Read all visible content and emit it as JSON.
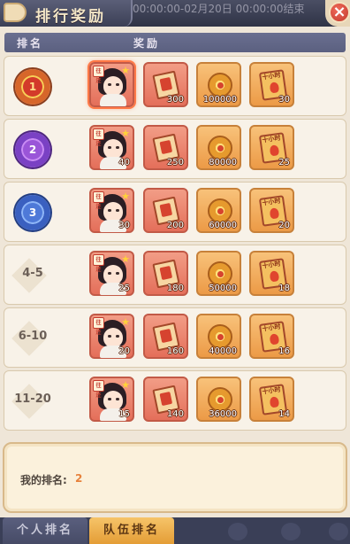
{
  "title": "排行奖励",
  "time_range": "00:00:00-02月20日 00:00:00结束",
  "close_icon_char": "×",
  "header": {
    "rank": "排名",
    "reward": "奖励"
  },
  "rows": [
    {
      "rank": "",
      "medal": "gold",
      "medal_value": "1",
      "items": [
        {
          "kind": "avatar",
          "count": "",
          "tag": "往还"
        },
        {
          "kind": "book",
          "count": "300"
        },
        {
          "kind": "coin",
          "count": "100000"
        },
        {
          "kind": "ticket",
          "count": "30",
          "label": "十小时"
        }
      ]
    },
    {
      "rank": "",
      "medal": "purple",
      "medal_value": "2",
      "items": [
        {
          "kind": "avatar",
          "count": "40",
          "tag": "往还"
        },
        {
          "kind": "book",
          "count": "250"
        },
        {
          "kind": "coin",
          "count": "80000"
        },
        {
          "kind": "ticket",
          "count": "25",
          "label": "十小时"
        }
      ]
    },
    {
      "rank": "",
      "medal": "blue",
      "medal_value": "3",
      "items": [
        {
          "kind": "avatar",
          "count": "30",
          "tag": "往还"
        },
        {
          "kind": "book",
          "count": "200"
        },
        {
          "kind": "coin",
          "count": "60000"
        },
        {
          "kind": "ticket",
          "count": "20",
          "label": "十小时"
        }
      ]
    },
    {
      "rank": "4-5",
      "medal": "",
      "items": [
        {
          "kind": "avatar",
          "count": "25",
          "tag": "往还"
        },
        {
          "kind": "book",
          "count": "180"
        },
        {
          "kind": "coin",
          "count": "50000"
        },
        {
          "kind": "ticket",
          "count": "18",
          "label": "十小时"
        }
      ]
    },
    {
      "rank": "6-10",
      "medal": "",
      "items": [
        {
          "kind": "avatar",
          "count": "20",
          "tag": "往还"
        },
        {
          "kind": "book",
          "count": "160"
        },
        {
          "kind": "coin",
          "count": "40000"
        },
        {
          "kind": "ticket",
          "count": "16",
          "label": "十小时"
        }
      ]
    },
    {
      "rank": "11-20",
      "medal": "",
      "items": [
        {
          "kind": "avatar",
          "count": "15",
          "tag": "往还"
        },
        {
          "kind": "book",
          "count": "140"
        },
        {
          "kind": "coin",
          "count": "36000"
        },
        {
          "kind": "ticket",
          "count": "14",
          "label": "十小时"
        }
      ]
    }
  ],
  "my_rank": {
    "label": "我的排名:",
    "value": "2"
  },
  "tabs": [
    {
      "label": "个人排名",
      "active": false
    },
    {
      "label": "队伍排名",
      "active": true
    }
  ],
  "colors": {
    "accent": "#e7823c",
    "header_bg": "#6a6f90",
    "active_tab": "#e49d36"
  }
}
